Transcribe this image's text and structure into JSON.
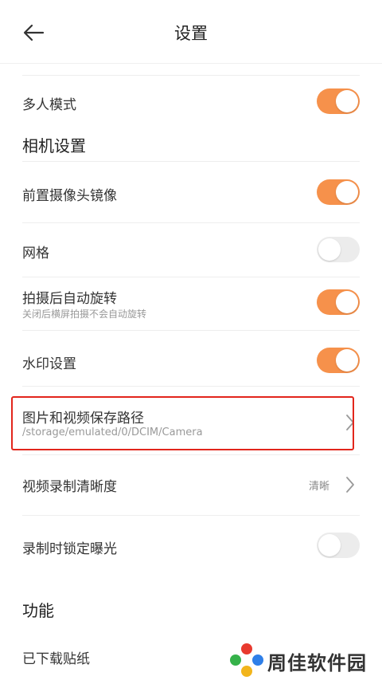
{
  "header": {
    "title": "设置"
  },
  "settings": {
    "multi_person": {
      "label": "多人模式",
      "enabled": true
    },
    "camera_section": "相机设置",
    "front_mirror": {
      "label": "前置摄像头镜像",
      "enabled": true
    },
    "grid": {
      "label": "网格",
      "enabled": false
    },
    "auto_rotate": {
      "label": "拍摄后自动旋转",
      "sub": "关闭后横屏拍摄不会自动旋转",
      "enabled": true
    },
    "watermark": {
      "label": "水印设置",
      "enabled": true
    },
    "save_path": {
      "label": "图片和视频保存路径",
      "sub": "/storage/emulated/0/DCIM/Camera"
    },
    "video_quality": {
      "label": "视频录制清晰度",
      "value": "清晰"
    },
    "lock_exposure": {
      "label": "录制时锁定曝光",
      "enabled": false
    },
    "function_section": "功能",
    "stickers": {
      "label": "已下载贴纸"
    }
  },
  "watermark_logo": {
    "text": "周佳软件园"
  },
  "colors": {
    "accent": "#f6914b",
    "highlight": "#e2261c"
  }
}
